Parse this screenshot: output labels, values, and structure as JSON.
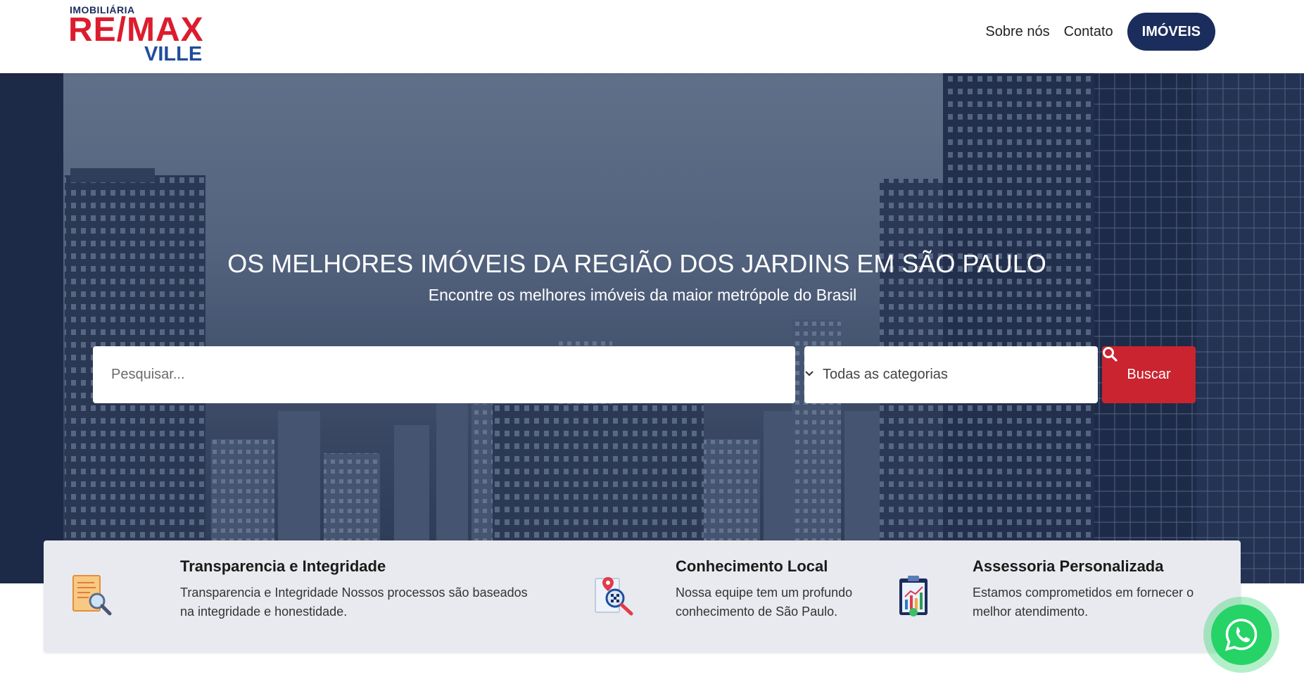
{
  "brand": {
    "top": "IMOBILIÁRIA",
    "main": "RE/MAX",
    "sub": "VILLE"
  },
  "nav": {
    "about": "Sobre nós",
    "contact": "Contato",
    "properties": "IMÓVEIS"
  },
  "hero": {
    "title": "OS MELHORES IMÓVEIS DA REGIÃO DOS JARDINS EM SÃO PAULO",
    "subtitle": "Encontre os melhores imóveis da maior metrópole do Brasil"
  },
  "search": {
    "placeholder": "Pesquisar...",
    "category_selected": "Todas as categorias",
    "button_label": "Buscar"
  },
  "features": [
    {
      "title": "Transparencia e Integridade",
      "description": "Transparencia e Integridade Nossos processos são baseados na integridade e honestidade.",
      "icon": "document-search-icon"
    },
    {
      "title": "Conhecimento Local",
      "description": "Nossa equipe tem um profundo conhecimento de São Paulo.",
      "icon": "location-search-icon"
    },
    {
      "title": "Assessoria Personalizada",
      "description": "Estamos comprometidos em fornecer o melhor atendimento.",
      "icon": "clipboard-chart-icon"
    }
  ],
  "colors": {
    "brand_navy": "#1b2d5c",
    "brand_red": "#dc1c2e",
    "button_red": "#c9242f",
    "whatsapp_green": "#25d366"
  }
}
